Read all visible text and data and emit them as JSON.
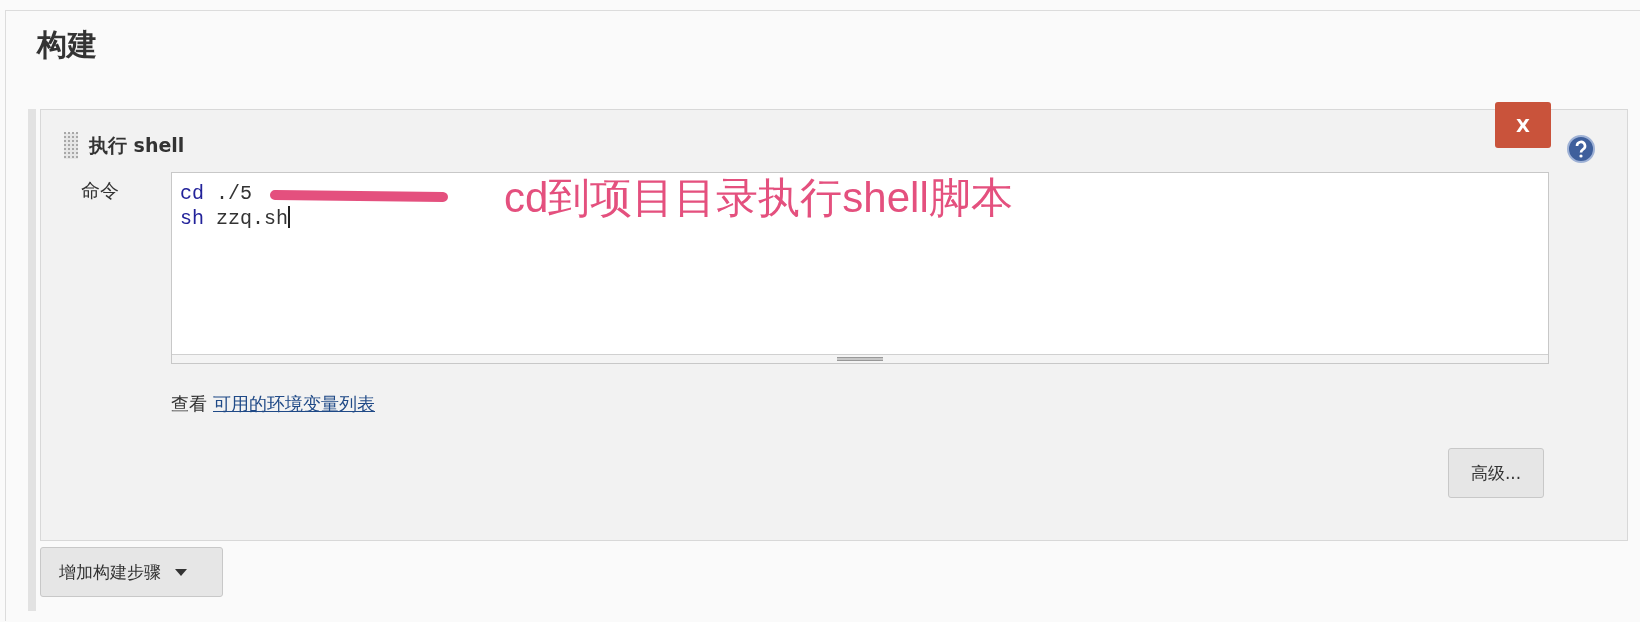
{
  "section": {
    "title": "构建"
  },
  "build_step": {
    "title": "执行 shell",
    "delete_button": "X",
    "field_label": "命令",
    "command_lines": [
      {
        "keyword": "cd",
        "args": " ./5"
      },
      {
        "keyword": "sh",
        "args": " zzq.sh"
      }
    ],
    "hint": "查看",
    "link": "可用的环境变量列表",
    "advanced_button": "高级..."
  },
  "annotation": "cd到项目目录执行shell脚本",
  "add_step_button": "增加构建步骤"
}
